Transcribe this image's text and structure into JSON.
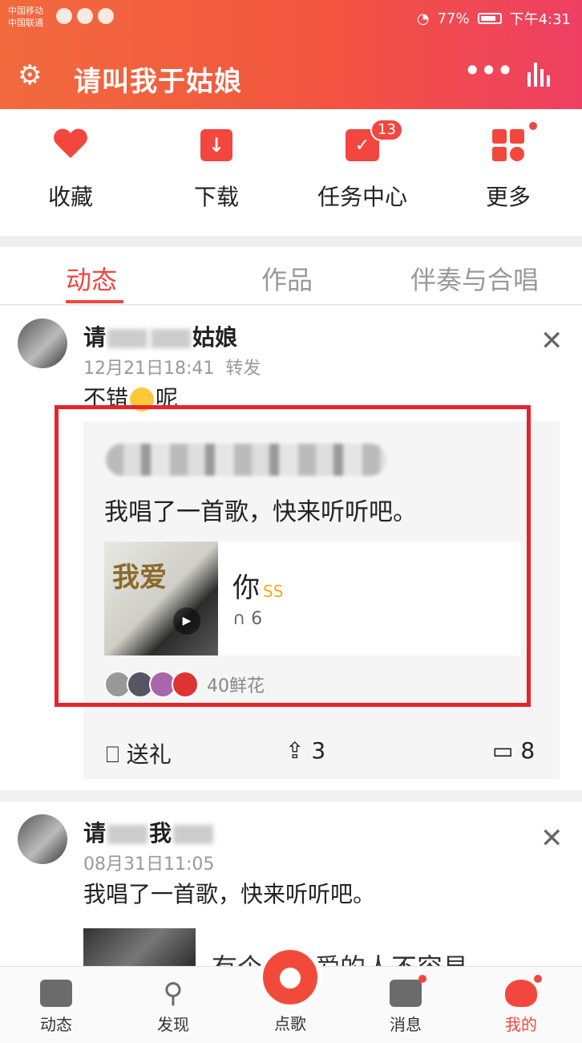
{
  "status_bar": {
    "carrier1": "中国移动",
    "carrier2": "中国联通",
    "battery": "77%",
    "time": "下午4:31"
  },
  "header": {
    "title": "请叫我于姑娘",
    "settings_icon": "gear-icon",
    "more_icon": "more-dots-icon",
    "chart_icon": "bar-chart-icon"
  },
  "quick_actions": [
    {
      "label": "收藏",
      "icon": "heart-icon"
    },
    {
      "label": "下载",
      "icon": "download-icon"
    },
    {
      "label": "任务中心",
      "icon": "calendar-check-icon",
      "badge": "13"
    },
    {
      "label": "更多",
      "icon": "grid-icon"
    }
  ],
  "tabs": [
    {
      "label": "动态",
      "active": true
    },
    {
      "label": "作品",
      "active": false
    },
    {
      "label": "伴奏与合唱",
      "active": false
    }
  ],
  "post1": {
    "name_start": "请",
    "name_end": "姑娘",
    "time": "12月21日18:41",
    "type": "转发",
    "text_a": "不错",
    "text_b": "呢",
    "quote_text": "我唱了一首歌，快来听听吧。",
    "cover_text": "我爱",
    "song_title": "你",
    "song_tag": "SS",
    "plays": "6",
    "flowers": "40鲜花",
    "gift_label": "送礼",
    "share_count": "3",
    "comment_count": "8"
  },
  "post2": {
    "name_start": "请",
    "name_end": "我",
    "time": "08月31日11:05",
    "text": "我唱了一首歌，快来听听吧。",
    "partial_title": "有个曾经爱的人不容易"
  },
  "bottom_nav": [
    {
      "label": "动态",
      "icon": "chat-icon"
    },
    {
      "label": "发现",
      "icon": "search-icon"
    },
    {
      "label": "点歌",
      "icon": "mic-icon"
    },
    {
      "label": "消息",
      "icon": "mail-icon"
    },
    {
      "label": "我的",
      "icon": "profile-icon"
    }
  ],
  "colors": {
    "accent": "#f2473f",
    "header_start": "#f26a3d",
    "header_end": "#ee3f63"
  }
}
